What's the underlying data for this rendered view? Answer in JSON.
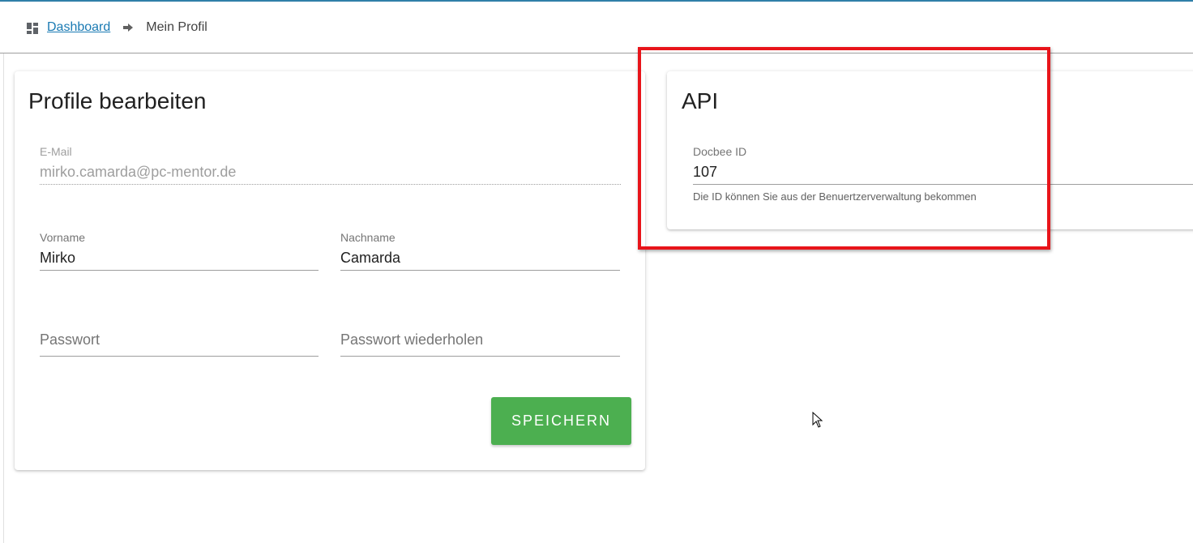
{
  "breadcrumb": {
    "icon": "dashboard-icon",
    "home_label": "Dashboard",
    "separator_icon": "arrow-right-icon",
    "current_label": "Mein Profil"
  },
  "profile_card": {
    "title": "Profile bearbeiten",
    "email": {
      "label": "E-Mail",
      "value": "mirko.camarda@pc-mentor.de"
    },
    "first_name": {
      "label": "Vorname",
      "value": "Mirko"
    },
    "last_name": {
      "label": "Nachname",
      "value": "Camarda"
    },
    "password": {
      "placeholder": "Passwort"
    },
    "password_repeat": {
      "placeholder": "Passwort wiederholen"
    },
    "save_label": "SPEICHERN"
  },
  "api_card": {
    "title": "API",
    "docbee_id": {
      "label": "Docbee ID",
      "value": "107"
    },
    "hint": "Die ID können Sie aus der Benuertzerverwaltung bekommen"
  },
  "colors": {
    "accent": "#2f7fa8",
    "link": "#1a7ab3",
    "save_button": "#4caf50",
    "highlight": "#e8141a"
  }
}
